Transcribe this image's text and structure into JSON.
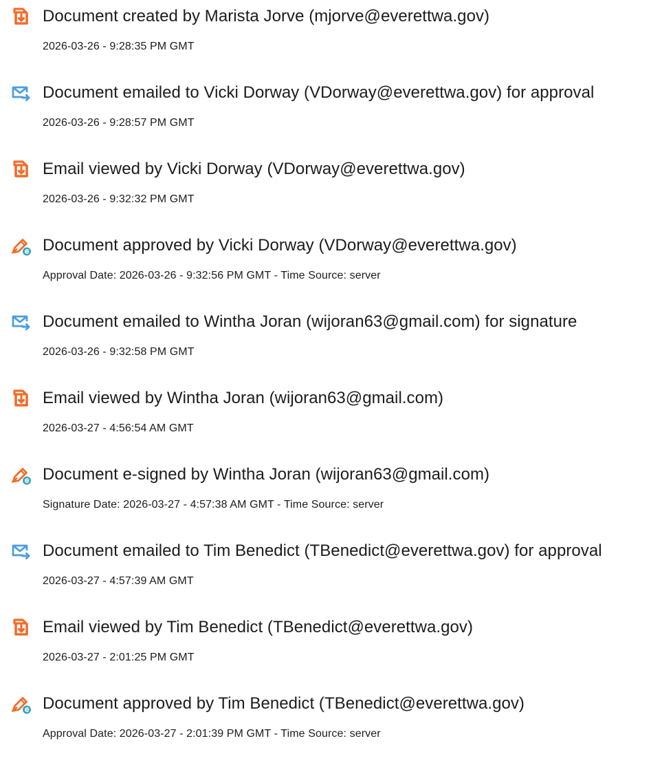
{
  "icons": {
    "document": "document-arrow-icon",
    "email": "email-send-icon",
    "sign": "pen-sign-icon"
  },
  "colors": {
    "document_icon": "#f26c2b",
    "email_icon": "#4a9fe0",
    "sign_icon": "#3aa5b8",
    "text": "#1c1c1c"
  },
  "events": [
    {
      "icon": "document",
      "title": "Document created by Marista Jorve (mjorve@everettwa.gov)",
      "detail": "2026-03-26 - 9:28:35 PM GMT"
    },
    {
      "icon": "email",
      "title": "Document emailed to Vicki Dorway (VDorway@everettwa.gov) for approval",
      "detail": "2026-03-26 - 9:28:57 PM GMT"
    },
    {
      "icon": "document",
      "title": "Email viewed by Vicki Dorway (VDorway@everettwa.gov)",
      "detail": "2026-03-26 - 9:32:32 PM GMT"
    },
    {
      "icon": "sign",
      "title": "Document approved by Vicki Dorway (VDorway@everettwa.gov)",
      "detail": "Approval Date: 2026-03-26 - 9:32:56 PM GMT - Time Source: server"
    },
    {
      "icon": "email",
      "title": "Document emailed to Wintha Joran (wijoran63@gmail.com) for signature",
      "detail": "2026-03-26 - 9:32:58 PM GMT"
    },
    {
      "icon": "document",
      "title": "Email viewed by Wintha Joran (wijoran63@gmail.com)",
      "detail": "2026-03-27 - 4:56:54 AM GMT"
    },
    {
      "icon": "sign",
      "title": "Document e-signed by Wintha Joran (wijoran63@gmail.com)",
      "detail": "Signature Date: 2026-03-27 - 4:57:38 AM GMT - Time Source: server"
    },
    {
      "icon": "email",
      "title": "Document emailed to Tim Benedict (TBenedict@everettwa.gov) for approval",
      "detail": "2026-03-27 - 4:57:39 AM GMT"
    },
    {
      "icon": "document",
      "title": "Email viewed by Tim Benedict (TBenedict@everettwa.gov)",
      "detail": "2026-03-27 - 2:01:25 PM GMT"
    },
    {
      "icon": "sign",
      "title": "Document approved by Tim Benedict (TBenedict@everettwa.gov)",
      "detail": "Approval Date: 2026-03-27 - 2:01:39 PM GMT - Time Source: server"
    }
  ]
}
